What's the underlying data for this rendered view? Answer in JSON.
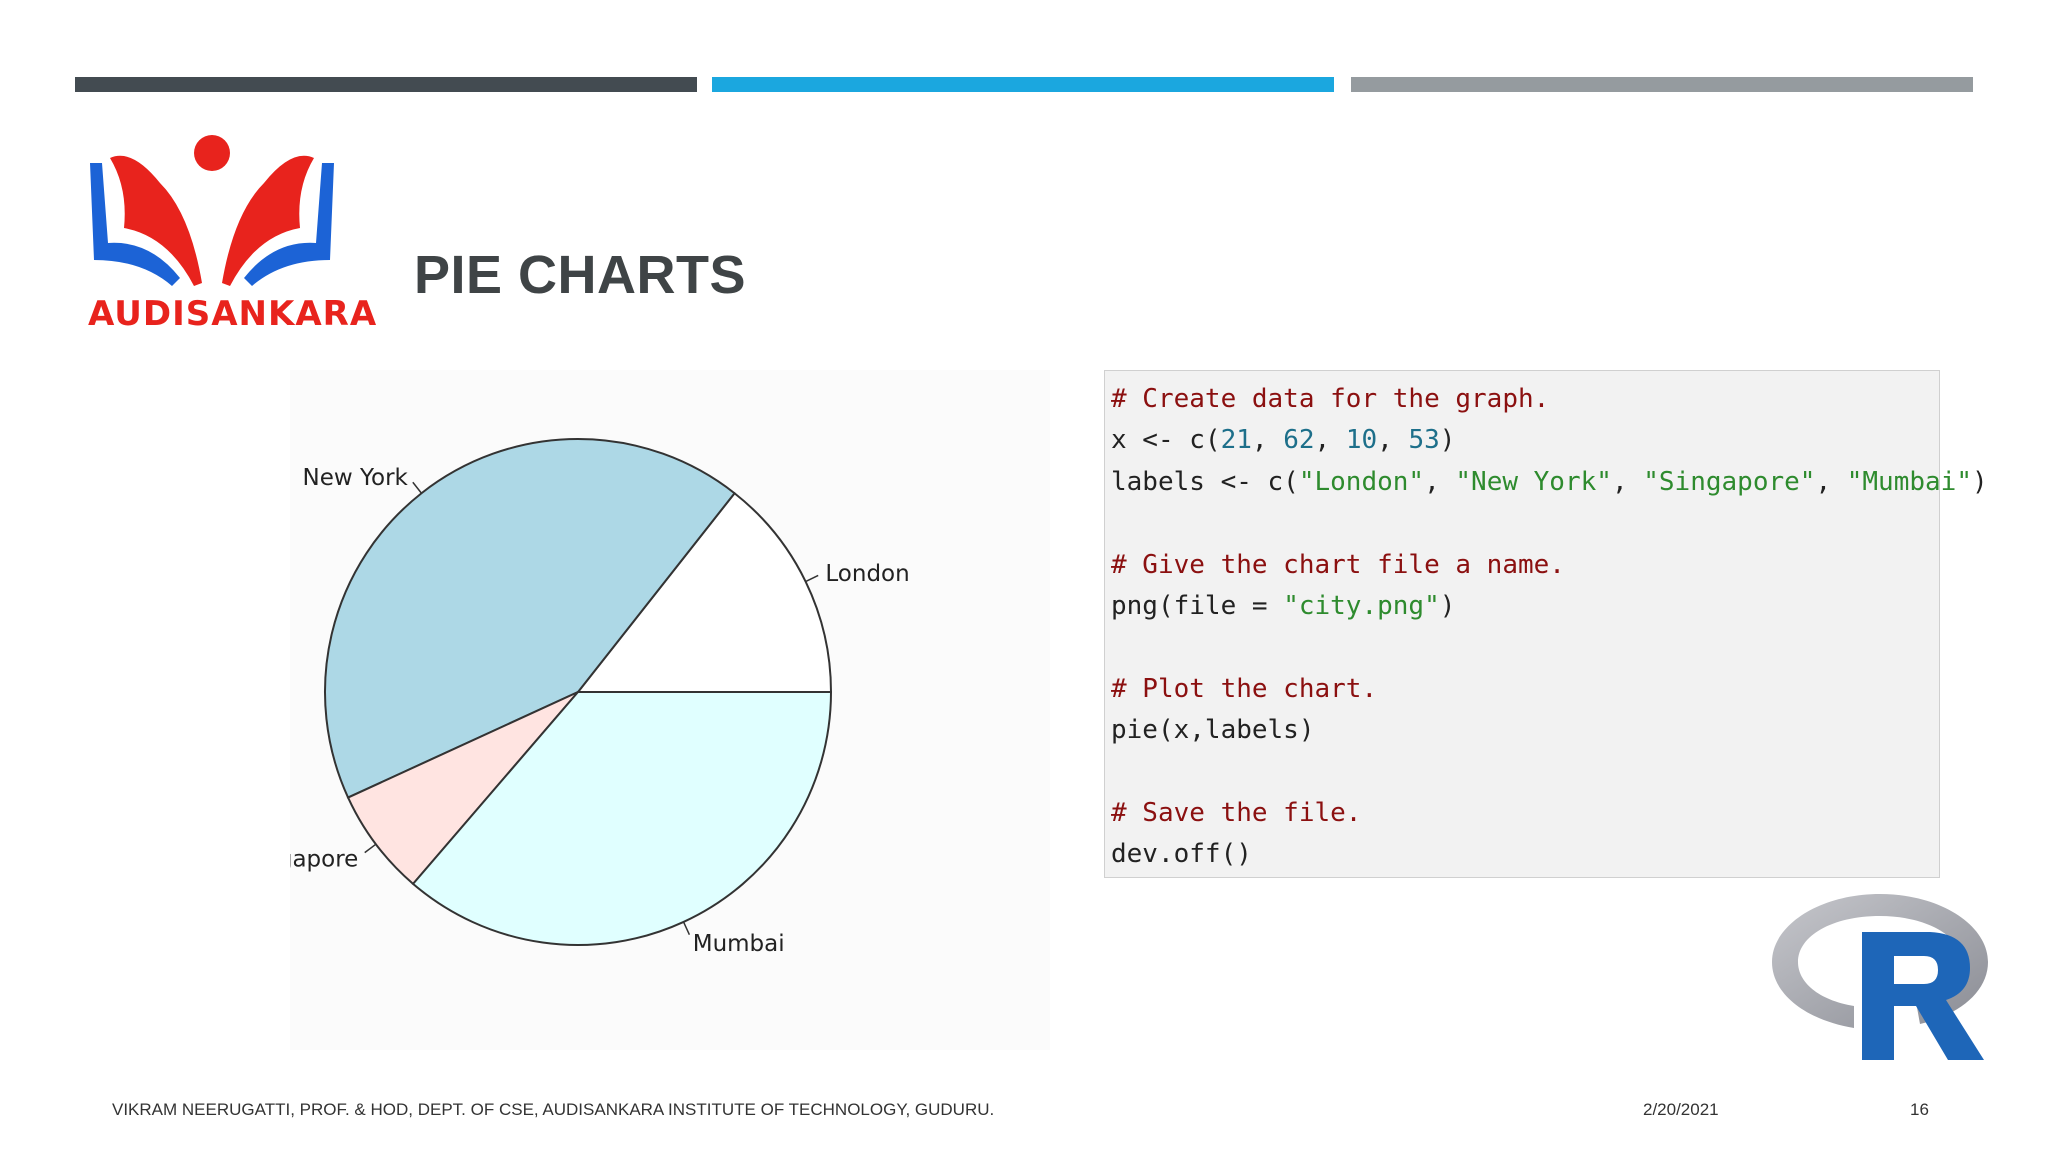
{
  "colors": {
    "bar_dark": "#434b51",
    "bar_blue": "#1ba7df",
    "bar_grey": "#959b9f",
    "logo_red": "#e8231d",
    "logo_blue": "#1c63d6",
    "r_blue": "#1e66b8",
    "r_grey": "#9a9ca3",
    "pie_fills": [
      "#ffffff",
      "#add8e6",
      "#ffe4e1",
      "#e0ffff"
    ]
  },
  "logo": {
    "text": "AUDISANKARA"
  },
  "slide": {
    "title": "PIE CHARTS"
  },
  "chart_data": {
    "type": "pie",
    "labels": [
      "London",
      "New York",
      "Singapore",
      "Mumbai"
    ],
    "values": [
      21,
      62,
      10,
      53
    ],
    "title": "",
    "start": "3 o'clock, counter-clockwise"
  },
  "code": {
    "lines": [
      [
        {
          "t": "# Create data for the graph.",
          "k": "comment"
        }
      ],
      [
        {
          "t": "x <- c(",
          "k": "plain"
        },
        {
          "t": "21",
          "k": "num"
        },
        {
          "t": ", ",
          "k": "plain"
        },
        {
          "t": "62",
          "k": "num"
        },
        {
          "t": ", ",
          "k": "plain"
        },
        {
          "t": "10",
          "k": "num"
        },
        {
          "t": ", ",
          "k": "plain"
        },
        {
          "t": "53",
          "k": "num"
        },
        {
          "t": ")",
          "k": "plain"
        }
      ],
      [
        {
          "t": "labels <- c(",
          "k": "plain"
        },
        {
          "t": "\"London\"",
          "k": "str"
        },
        {
          "t": ", ",
          "k": "plain"
        },
        {
          "t": "\"New York\"",
          "k": "str"
        },
        {
          "t": ", ",
          "k": "plain"
        },
        {
          "t": "\"Singapore\"",
          "k": "str"
        },
        {
          "t": ", ",
          "k": "plain"
        },
        {
          "t": "\"Mumbai\"",
          "k": "str"
        },
        {
          "t": ")",
          "k": "plain"
        }
      ],
      [],
      [
        {
          "t": "# Give the chart file a name.",
          "k": "comment"
        }
      ],
      [
        {
          "t": "png(file = ",
          "k": "plain"
        },
        {
          "t": "\"city.png\"",
          "k": "str"
        },
        {
          "t": ")",
          "k": "plain"
        }
      ],
      [],
      [
        {
          "t": "# Plot the chart.",
          "k": "comment"
        }
      ],
      [
        {
          "t": "pie(x,labels)",
          "k": "plain"
        }
      ],
      [],
      [
        {
          "t": "# Save the file.",
          "k": "comment"
        }
      ],
      [
        {
          "t": "dev.off()",
          "k": "plain"
        }
      ]
    ]
  },
  "icons": {
    "r_logo": "r-logo-icon",
    "brand_logo": "audisankara-logo-icon"
  },
  "footer": {
    "left": "VIKRAM NEERUGATTI, PROF. & HOD, DEPT. OF CSE, AUDISANKARA INSTITUTE OF TECHNOLOGY, GUDURU.",
    "date": "2/20/2021",
    "page": "16"
  }
}
